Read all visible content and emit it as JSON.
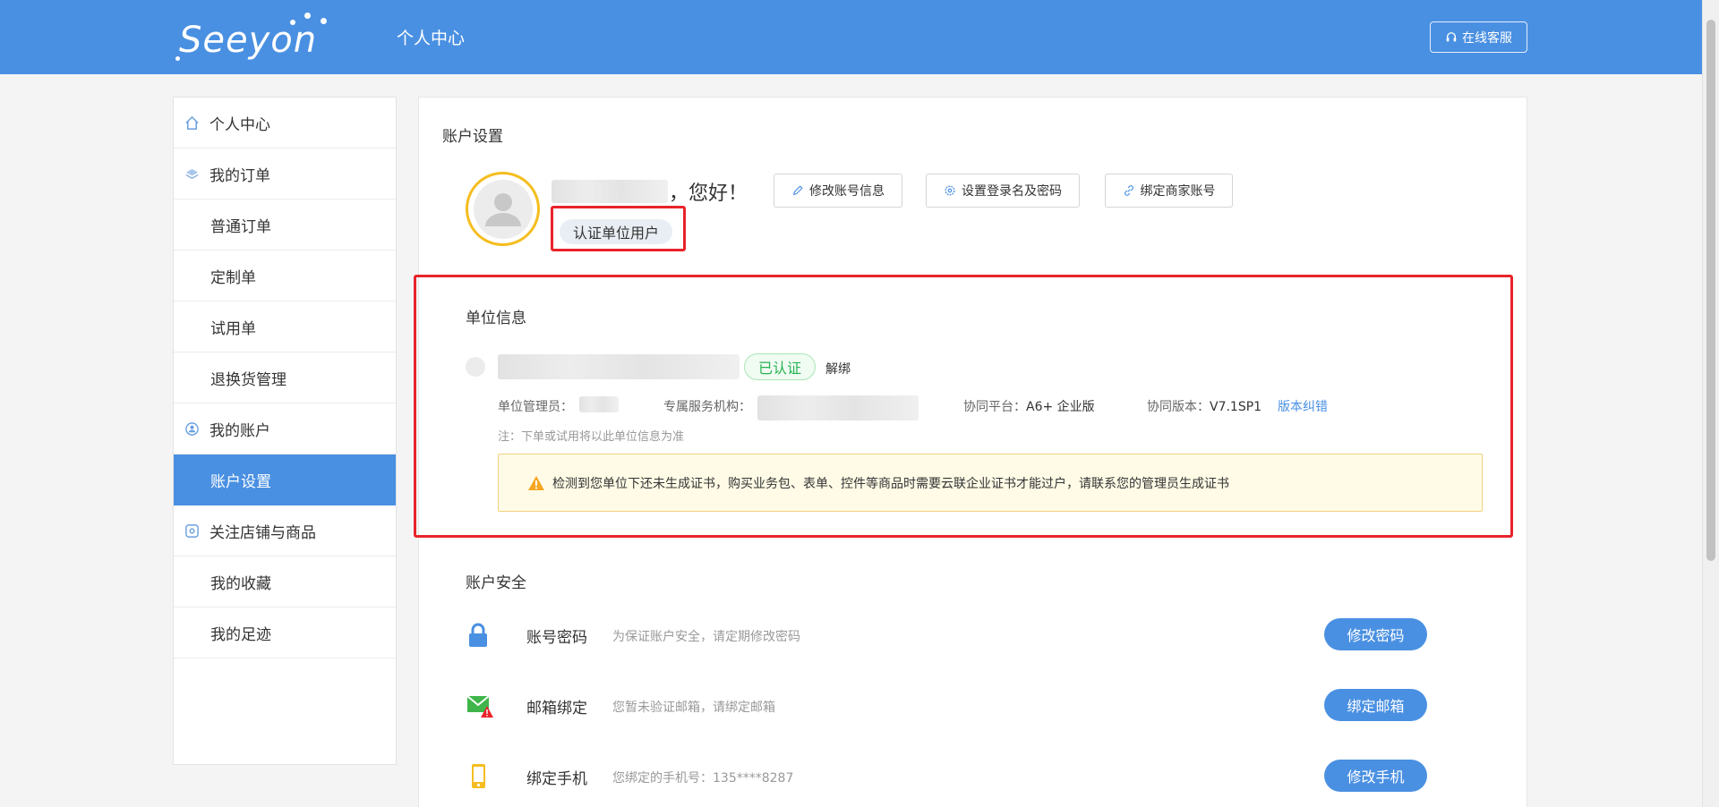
{
  "header": {
    "logo_text": "Seeyon",
    "title": "个人中心",
    "service_label": "在线客服",
    "colors": {
      "primary": "#4a90e2"
    }
  },
  "sidebar": {
    "items": [
      {
        "label": "个人中心",
        "icon": "home-icon"
      },
      {
        "label": "我的订单",
        "icon": "layers-icon"
      },
      {
        "label": "普通订单"
      },
      {
        "label": "定制单"
      },
      {
        "label": "试用单"
      },
      {
        "label": "退换货管理"
      },
      {
        "label": "我的账户",
        "icon": "user-circle-icon"
      },
      {
        "label": "账户设置",
        "active": true
      },
      {
        "label": "关注店铺与商品",
        "icon": "store-icon"
      },
      {
        "label": "我的收藏"
      },
      {
        "label": "我的足迹"
      }
    ]
  },
  "account": {
    "section_title": "账户设置",
    "greeting": "，您好！",
    "cert_tag": "认证单位用户",
    "buttons": {
      "edit_info": "修改账号信息",
      "login_password": "设置登录名及密码",
      "bind_merchant": "绑定商家账号"
    }
  },
  "unit": {
    "section_title": "单位信息",
    "verified_tag": "已认证",
    "unbind": "解绑",
    "admin_label": "单位管理员：",
    "service_org_label": "专属服务机构：",
    "platform_label": "协同平台：",
    "platform_value": "A6+ 企业版",
    "version_label": "协同版本：",
    "version_value": "V7.1SP1",
    "version_link": "版本纠错",
    "note": "注：下单或试用将以此单位信息为准",
    "warning": "检测到您单位下还未生成证书，购买业务包、表单、控件等商品时需要云联企业证书才能过户，请联系您的管理员生成证书"
  },
  "security": {
    "section_title": "账户安全",
    "rows": [
      {
        "name": "账号密码",
        "desc": "为保证账户安全，请定期修改密码",
        "button": "修改密码",
        "icon": "lock-icon"
      },
      {
        "name": "邮箱绑定",
        "desc": "您暂未验证邮箱，请绑定邮箱",
        "button": "绑定邮箱",
        "icon": "mail-warning-icon"
      },
      {
        "name": "绑定手机",
        "desc": "您绑定的手机号：135****8287",
        "button": "修改手机",
        "icon": "phone-icon"
      }
    ]
  }
}
